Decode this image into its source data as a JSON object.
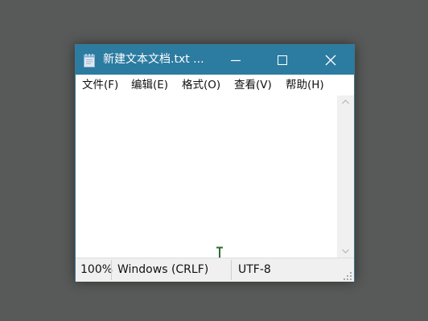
{
  "window": {
    "title": "新建文本文档.txt ...",
    "icon": "notepad-icon",
    "controls": {
      "minimize_icon": "minimize-icon",
      "maximize_icon": "maximize-icon",
      "close_icon": "close-icon"
    }
  },
  "menu": {
    "items": [
      {
        "label": "文件(F)"
      },
      {
        "label": "编辑(E)"
      },
      {
        "label": "格式(O)"
      },
      {
        "label": "查看(V)"
      },
      {
        "label": "帮助(H)"
      }
    ]
  },
  "editor": {
    "content": "",
    "cursor_icon": "text-cursor-icon"
  },
  "status": {
    "zoom": "100%",
    "line_ending": "Windows (CRLF)",
    "encoding": "UTF-8"
  },
  "colors": {
    "titlebar": "#2c7ba0",
    "desktop": "#575a58",
    "cursor": "#2f6b2f"
  }
}
